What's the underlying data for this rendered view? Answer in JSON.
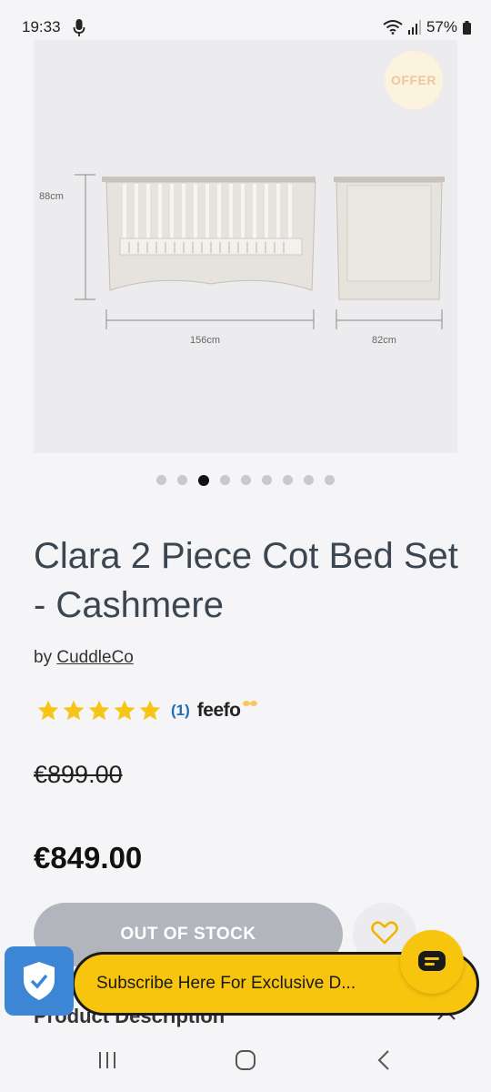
{
  "status_bar": {
    "time": "19:33",
    "battery": "57%"
  },
  "product_image": {
    "offer_badge": "OFFER",
    "height_label": "88cm",
    "width_label": "156cm",
    "depth_label": "82cm",
    "carousel_total": 9,
    "carousel_active": 3
  },
  "product": {
    "title": "Clara 2 Piece Cot Bed Set - Cashmere",
    "brand_prefix": "by",
    "brand": "CuddleCo",
    "rating_stars": 5,
    "review_count": "(1)",
    "review_provider": "feefo",
    "old_price": "€899.00",
    "price": "€849.00"
  },
  "actions": {
    "stock_button": "OUT OF STOCK"
  },
  "sections": {
    "description_header": "Product Description"
  },
  "subscribe": {
    "text": "Subscribe Here For Exclusive D..."
  },
  "colors": {
    "accent_yellow": "#f7c50e",
    "shield_blue": "#3d86d5",
    "star_yellow": "#f5c518",
    "disabled_grey": "#b2b6bc",
    "link_blue": "#1f6fb5"
  }
}
